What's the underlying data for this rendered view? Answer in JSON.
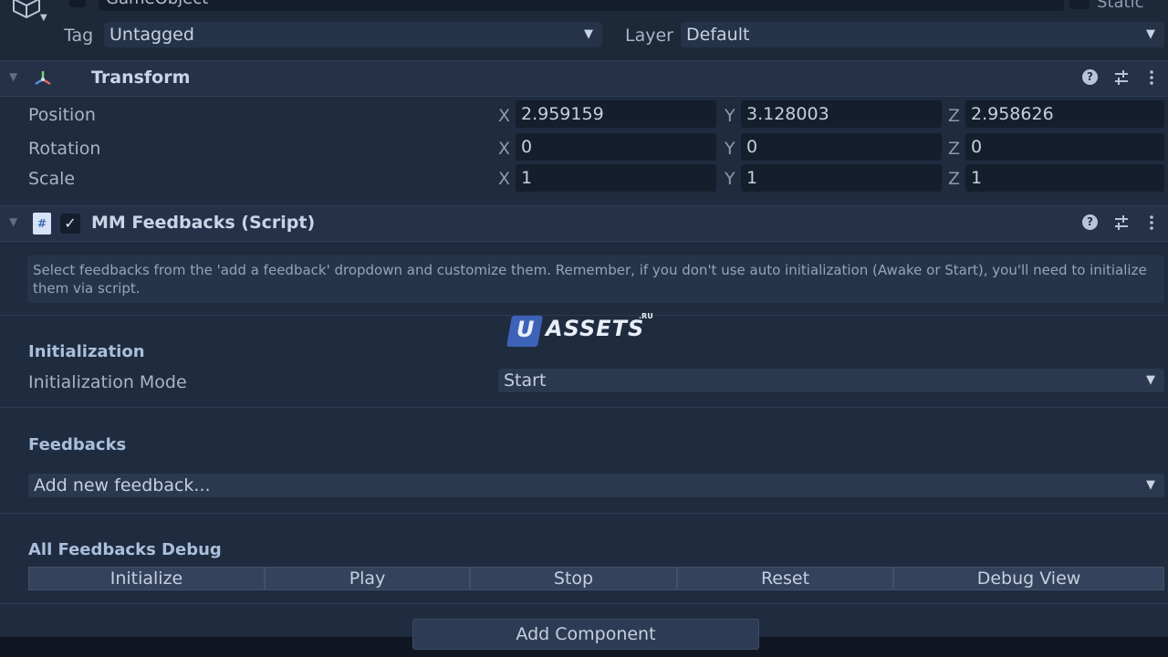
{
  "object": {
    "name": "GameObject",
    "static_label": "Static",
    "tag_label": "Tag",
    "tag_value": "Untagged",
    "layer_label": "Layer",
    "layer_value": "Default"
  },
  "transform": {
    "title": "Transform",
    "rows": [
      {
        "label": "Position",
        "x": "2.959159",
        "y": "3.128003",
        "z": "2.958626"
      },
      {
        "label": "Rotation",
        "x": "0",
        "y": "0",
        "z": "0"
      },
      {
        "label": "Scale",
        "x": "1",
        "y": "1",
        "z": "1"
      }
    ],
    "axis": {
      "x": "X",
      "y": "Y",
      "z": "Z"
    }
  },
  "feedbacks_component": {
    "title": "MM Feedbacks (Script)",
    "enabled": true,
    "help_text": "Select feedbacks from the 'add a feedback' dropdown and customize them. Remember, if you don't use auto initialization (Awake or Start), you'll need to initialize them via script.",
    "initialization": {
      "section_title": "Initialization",
      "mode_label": "Initialization Mode",
      "mode_value": "Start"
    },
    "feedbacks": {
      "section_title": "Feedbacks",
      "add_placeholder": "Add new feedback..."
    },
    "debug": {
      "section_title": "All Feedbacks Debug",
      "buttons": [
        "Initialize",
        "Play",
        "Stop",
        "Reset",
        "Debug View"
      ]
    }
  },
  "add_component_label": "Add Component",
  "watermark": {
    "badge": "U",
    "text": "ASSETS",
    "suffix": ".RU"
  },
  "icons": {
    "help": "help-icon",
    "preset": "sliders-icon",
    "menu": "kebab-menu-icon",
    "dropdown": "triangle-down-icon"
  }
}
